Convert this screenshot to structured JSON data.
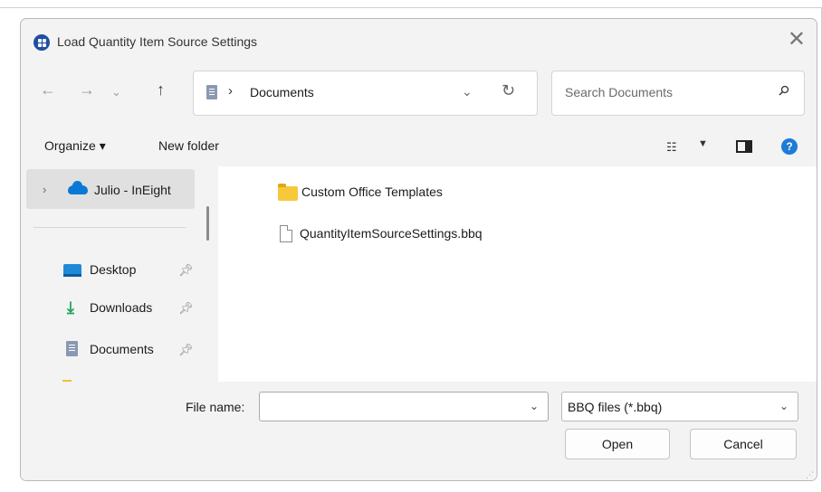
{
  "dialog": {
    "title": "Load Quantity Item Source Settings",
    "close_icon": "close-x-icon"
  },
  "nav": {
    "back_icon": "arrow-left-icon",
    "forward_icon": "arrow-right-icon",
    "recent_icon": "chevron-down-icon",
    "up_icon": "arrow-up-icon"
  },
  "address": {
    "separator": "›",
    "location": "Documents"
  },
  "search": {
    "placeholder": "Search Documents"
  },
  "toolbar": {
    "organize_label": "Organize ▾",
    "new_folder_label": "New folder",
    "view_icon": "view-list-icon",
    "help_label": "?"
  },
  "sidebar": {
    "tree_root": "Julio - InEight",
    "quick_access": [
      {
        "label": "Desktop",
        "icon": "desktop-icon"
      },
      {
        "label": "Downloads",
        "icon": "download-icon"
      },
      {
        "label": "Documents",
        "icon": "documents-icon"
      }
    ]
  },
  "files": [
    {
      "name": "Custom Office Templates",
      "kind": "folder"
    },
    {
      "name": "QuantityItemSourceSettings.bbq",
      "kind": "file"
    }
  ],
  "footer": {
    "file_name_label": "File name:",
    "file_name_value": "",
    "file_type": "BBQ files (*.bbq)",
    "open_label": "Open",
    "cancel_label": "Cancel"
  },
  "colors": {
    "accent": "#1e7cd6",
    "folder": "#f6c83a",
    "dialog_bg": "#f3f3f3"
  }
}
